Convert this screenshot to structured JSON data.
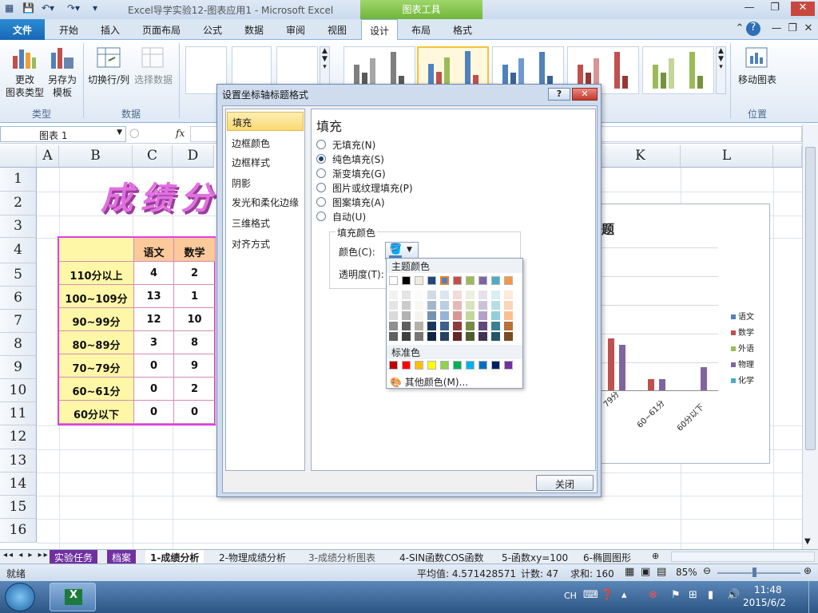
{
  "window": {
    "title": "Excel导学实验12-图表应用1  -  Microsoft Excel",
    "tool_context": "图表工具"
  },
  "ribbon_tabs": [
    "文件",
    "开始",
    "插入",
    "页面布局",
    "公式",
    "数据",
    "审阅",
    "视图",
    "设计",
    "布局",
    "格式"
  ],
  "ribbon": {
    "type_group": {
      "label": "类型",
      "change_type": "更改\n图表类型",
      "save_template": "另存为\n模板"
    },
    "data_group": {
      "label": "数据",
      "switch_rowcol": "切换行/列",
      "select_data": "选择数据"
    },
    "location_group": {
      "label": "位置",
      "move_chart": "移动图表"
    }
  },
  "formula_bar": {
    "name_box": "图表  1",
    "fx": "fx"
  },
  "columns": [
    "A",
    "B",
    "C",
    "D",
    "K",
    "L"
  ],
  "rows": [
    "1",
    "2",
    "3",
    "4",
    "5",
    "6",
    "7",
    "8",
    "9",
    "10",
    "11",
    "12",
    "13",
    "14",
    "15",
    "16"
  ],
  "sheet": {
    "banner_text": "成绩分",
    "table_headers": [
      "语文",
      "数学"
    ],
    "table_rows": [
      {
        "label": "110分以上",
        "c": "4",
        "d": "2"
      },
      {
        "label": "100~109分",
        "c": "13",
        "d": "1"
      },
      {
        "label": "90~99分",
        "c": "12",
        "d": "10"
      },
      {
        "label": "80~89分",
        "c": "3",
        "d": "8"
      },
      {
        "label": "70~79分",
        "c": "0",
        "d": "9"
      },
      {
        "label": "60~61分",
        "c": "0",
        "d": "2"
      },
      {
        "label": "60分以下",
        "c": "0",
        "d": "0"
      }
    ]
  },
  "chart": {
    "title_fragment": "题",
    "legend": [
      "语文",
      "数学",
      "外语",
      "物理",
      "化学"
    ],
    "legend_colors": [
      "#4f81bd",
      "#c0504d",
      "#9bbb59",
      "#8064a2",
      "#4bacc6"
    ],
    "x_labels": [
      "79分",
      "60~61分",
      "60分以下"
    ]
  },
  "dialog": {
    "title": "设置坐标轴标题格式",
    "help": "?",
    "nav": [
      "填充",
      "边框颜色",
      "边框样式",
      "阴影",
      "发光和柔化边缘",
      "三维格式",
      "对齐方式"
    ],
    "panel_title": "填充",
    "options": [
      "无填充(N)",
      "纯色填充(S)",
      "渐变填充(G)",
      "图片或纹理填充(P)",
      "图案填充(A)",
      "自动(U)"
    ],
    "selected_option": 1,
    "fill_color_group": "填充颜色",
    "color_label": "颜色(C):",
    "transparency_label": "透明度(T):",
    "close": "关闭"
  },
  "palette": {
    "theme_label": "主题颜色",
    "standard_label": "标准色",
    "more_colors": "其他颜色(M)...",
    "theme_top": [
      "#ffffff",
      "#000000",
      "#eeece1",
      "#1f497d",
      "#4f81bd",
      "#c0504d",
      "#9bbb59",
      "#8064a2",
      "#4bacc6",
      "#f79646"
    ],
    "standard": [
      "#c00000",
      "#ff0000",
      "#ffc000",
      "#ffff00",
      "#92d050",
      "#00b050",
      "#00b0f0",
      "#0070c0",
      "#002060",
      "#7030a0"
    ]
  },
  "sheet_tabs": [
    "实验任务",
    "档案",
    "1-成绩分析",
    "2-物理成绩分析",
    "3-成绩分析图表",
    "4-SIN函数COS函数",
    "5-函数xy=100",
    "6-椭圆图形"
  ],
  "status": {
    "ready": "就绪",
    "average": "平均值: 4.571428571",
    "count": "计数: 47",
    "sum": "求和: 160",
    "zoom": "85%"
  },
  "taskbar": {
    "lang": "CH",
    "time": "11:48",
    "date": "2015/6/2"
  }
}
